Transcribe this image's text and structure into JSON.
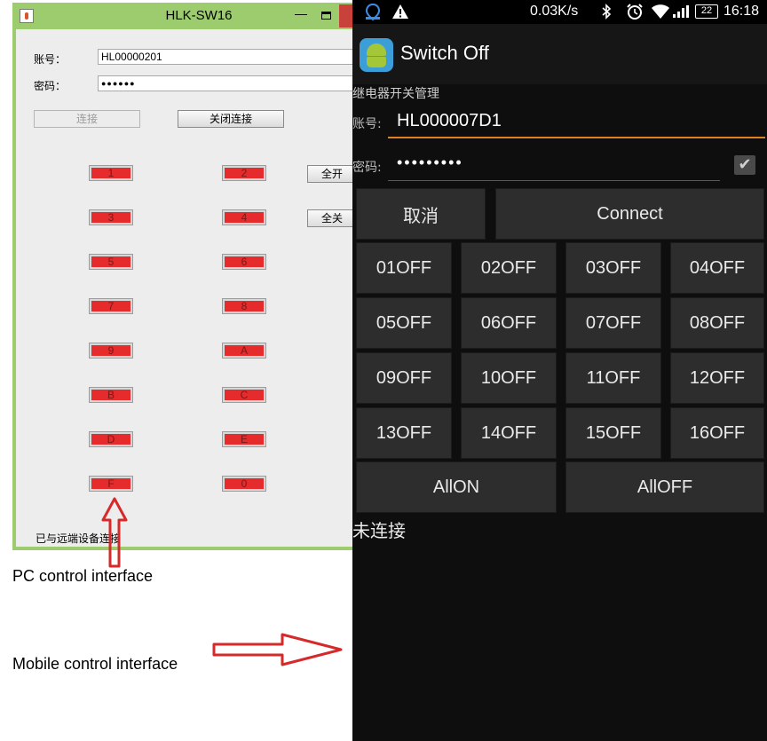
{
  "pc_window": {
    "title": "HLK-SW16",
    "minimize_glyph": "—",
    "account_label": "账号：",
    "account_value": "HL00000201",
    "password_label": "密码：",
    "password_value": "●●●●●●",
    "connect_button": "连接",
    "close_connection_button": "关闭连接",
    "all_on_button": "全开",
    "all_off_button": "全关",
    "relay_buttons": [
      "1",
      "2",
      "3",
      "4",
      "5",
      "6",
      "7",
      "8",
      "9",
      "A",
      "B",
      "C",
      "D",
      "E",
      "F",
      "0"
    ],
    "status_text": "已与远端设备连接"
  },
  "annotations": {
    "pc_caption": "PC control interface",
    "mobile_caption": "Mobile control interface"
  },
  "phone": {
    "status_bar": {
      "speed": "0.03K/s",
      "battery": "22",
      "time": "16:18"
    },
    "action_bar_title": "Switch Off",
    "heading": "继电器开关管理",
    "account_label": "账号:",
    "account_value": "HL000007D1",
    "password_label": "密码:",
    "password_value": "•••••••••",
    "checkbox_glyph": "✔",
    "cancel_button": "取消",
    "connect_button": "Connect",
    "relay_buttons": [
      "01OFF",
      "02OFF",
      "03OFF",
      "04OFF",
      "05OFF",
      "06OFF",
      "07OFF",
      "08OFF",
      "09OFF",
      "10OFF",
      "11OFF",
      "12OFF",
      "13OFF",
      "14OFF",
      "15OFF",
      "16OFF"
    ],
    "all_on_button": "AllON",
    "all_off_button": "AllOFF",
    "status_text": "未连接"
  },
  "colors": {
    "relay_red": "#e52b2b",
    "window_frame": "#9ccc6e",
    "arrow_red": "#d62a2a",
    "phone_accent": "#e0801f"
  }
}
